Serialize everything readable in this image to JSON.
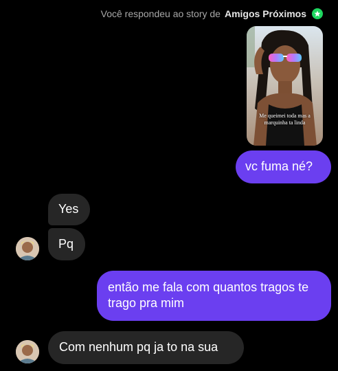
{
  "header": {
    "prefix": "Você respondeu ao story de",
    "owner": "Amigos Próximos",
    "badge_icon": "star-icon",
    "badge_color": "#1ed760"
  },
  "story": {
    "caption": "Me queimei toda mas a marquinha ta linda"
  },
  "messages": [
    {
      "from": "me",
      "text": "vc fuma né?"
    },
    {
      "from": "them",
      "text": "Yes"
    },
    {
      "from": "them",
      "text": "Pq"
    },
    {
      "from": "me",
      "text": "então me fala com quantos tragos te trago pra mim"
    },
    {
      "from": "them",
      "text": "Com nenhum pq ja to na sua"
    }
  ],
  "colors": {
    "background": "#000000",
    "sent_bubble": "#6b3ff0",
    "received_bubble": "#262626"
  }
}
